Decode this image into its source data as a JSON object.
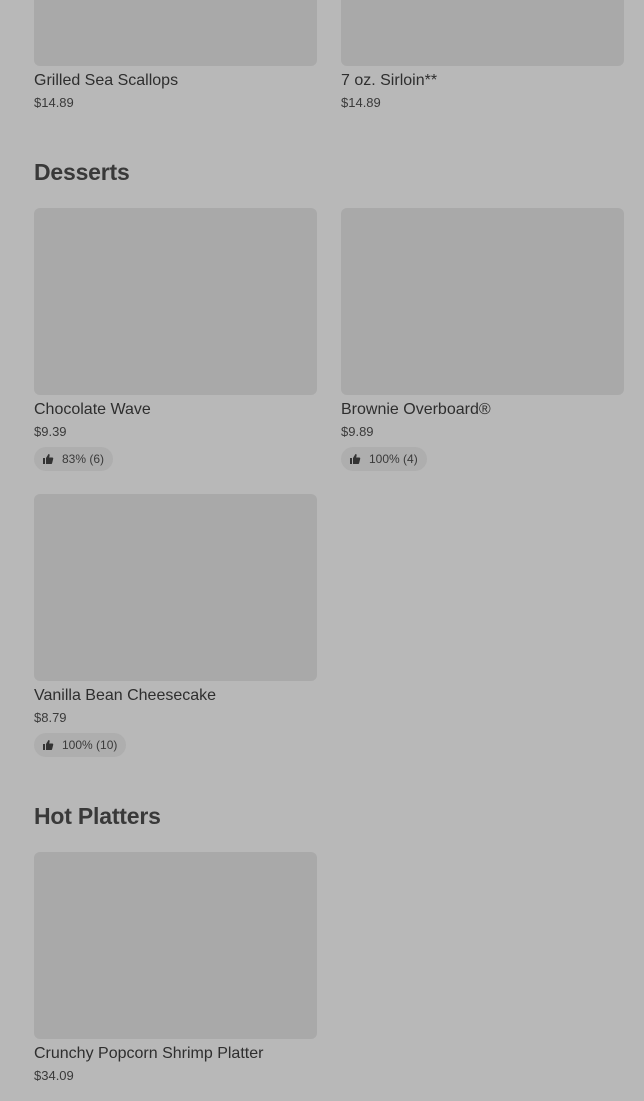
{
  "top_items": [
    {
      "name": "Grilled Sea Scallops",
      "price": "$14.89"
    },
    {
      "name": "7 oz. Sirloin**",
      "price": "$14.89"
    }
  ],
  "sections": {
    "desserts": {
      "title": "Desserts",
      "items": [
        {
          "name": "Chocolate Wave",
          "price": "$9.39",
          "rating": "83% (6)"
        },
        {
          "name": "Brownie Overboard®",
          "price": "$9.89",
          "rating": "100% (4)"
        },
        {
          "name": "Vanilla Bean Cheesecake",
          "price": "$8.79",
          "rating": "100% (10)"
        }
      ]
    },
    "hot_platters": {
      "title": "Hot Platters",
      "items": [
        {
          "name": "Crunchy Popcorn Shrimp Platter",
          "price": "$34.09"
        }
      ]
    }
  },
  "icons": {
    "rating": "thumbs-up-icon"
  },
  "colors": {
    "background": "#b8b8b8",
    "image_placeholder": "#a9a9a9",
    "badge_background": "#aeaeae"
  }
}
